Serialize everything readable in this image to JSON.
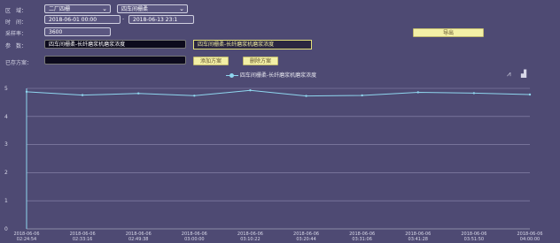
{
  "filters": {
    "area_label": "区　域：",
    "area_value": "二厂四栅",
    "area2_value": "四车间栅柔",
    "time_label": "时　间：",
    "start_time": "2018-06-01 00:00",
    "end_time": "2018-06-13 23:1",
    "interval_label": "采样率：",
    "interval_value": "3600",
    "param_label": "参　数：",
    "param_value": "四车间栅柔-长纤磨浆机磨浆浓度",
    "param_selected": "四车间栅柔-长纤磨浆机磨浆浓度",
    "scheme_label": "已存方案：",
    "scheme_value": ""
  },
  "buttons": {
    "export": "导出",
    "add_scheme": "添加方案",
    "delete_scheme": "删除方案"
  },
  "chart_data": {
    "type": "line",
    "title": "",
    "legend": [
      "四车间栅柔-长纤磨浆机磨浆浓度"
    ],
    "ylim": [
      0,
      5
    ],
    "yticks": [
      "5",
      "4",
      "3",
      "2",
      "1",
      "0"
    ],
    "x": [
      "2018-06-06 02:24",
      "2018-06-06 02:33:16",
      "2018-06-06 02:49:38",
      "2018-06-06 03:00:00",
      "2018-06-06 03:10:22",
      "2018-06-06 03:20:44",
      "2018-06-06 03:31:06",
      "2018-06-06 03:41:28",
      "2018-06-06 03:51:50",
      "2018-06-06 04:00"
    ],
    "xticks": [
      [
        "2018-06-06",
        "02:24:54"
      ],
      [
        "2018-06-06",
        "02:33:16"
      ],
      [
        "2018-06-06",
        "02:49:38"
      ],
      [
        "2018-06-06",
        "03:00:00"
      ],
      [
        "2018-06-06",
        "03:10:22"
      ],
      [
        "2018-06-06",
        "03:20:44"
      ],
      [
        "2018-06-06",
        "03:31:06"
      ],
      [
        "2018-06-06",
        "03:41:28"
      ],
      [
        "2018-06-06",
        "03:51:50"
      ],
      [
        "2018-06-06",
        "04:00:00"
      ]
    ],
    "series": [
      {
        "name": "四车间栅柔-长纤磨浆机磨浆浓度",
        "values": [
          4.88,
          4.76,
          4.82,
          4.74,
          4.93,
          4.73,
          4.75,
          4.86,
          4.83,
          4.78
        ],
        "color": "#8fd6ee"
      }
    ],
    "grid": true
  },
  "colors": {
    "background": "#4e4a73",
    "accent": "#f3f0a6",
    "line": "#8fd6ee"
  }
}
